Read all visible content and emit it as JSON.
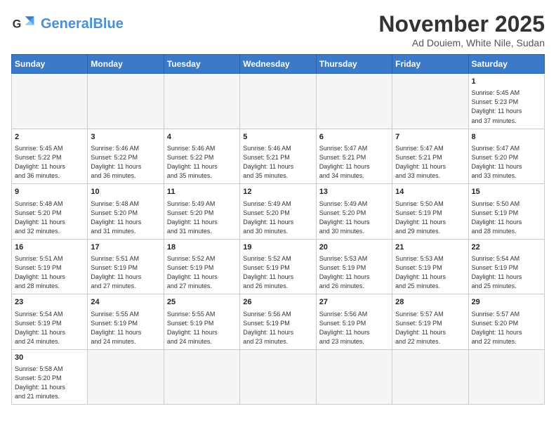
{
  "header": {
    "logo_general": "General",
    "logo_blue": "Blue",
    "month_title": "November 2025",
    "location": "Ad Douiem, White Nile, Sudan"
  },
  "days_of_week": [
    "Sunday",
    "Monday",
    "Tuesday",
    "Wednesday",
    "Thursday",
    "Friday",
    "Saturday"
  ],
  "weeks": [
    [
      {
        "day": null,
        "info": null
      },
      {
        "day": null,
        "info": null
      },
      {
        "day": null,
        "info": null
      },
      {
        "day": null,
        "info": null
      },
      {
        "day": null,
        "info": null
      },
      {
        "day": null,
        "info": null
      },
      {
        "day": "1",
        "info": "Sunrise: 5:45 AM\nSunset: 5:23 PM\nDaylight: 11 hours\nand 37 minutes."
      }
    ],
    [
      {
        "day": "2",
        "info": "Sunrise: 5:45 AM\nSunset: 5:22 PM\nDaylight: 11 hours\nand 36 minutes."
      },
      {
        "day": "3",
        "info": "Sunrise: 5:46 AM\nSunset: 5:22 PM\nDaylight: 11 hours\nand 36 minutes."
      },
      {
        "day": "4",
        "info": "Sunrise: 5:46 AM\nSunset: 5:22 PM\nDaylight: 11 hours\nand 35 minutes."
      },
      {
        "day": "5",
        "info": "Sunrise: 5:46 AM\nSunset: 5:21 PM\nDaylight: 11 hours\nand 35 minutes."
      },
      {
        "day": "6",
        "info": "Sunrise: 5:47 AM\nSunset: 5:21 PM\nDaylight: 11 hours\nand 34 minutes."
      },
      {
        "day": "7",
        "info": "Sunrise: 5:47 AM\nSunset: 5:21 PM\nDaylight: 11 hours\nand 33 minutes."
      },
      {
        "day": "8",
        "info": "Sunrise: 5:47 AM\nSunset: 5:20 PM\nDaylight: 11 hours\nand 33 minutes."
      }
    ],
    [
      {
        "day": "9",
        "info": "Sunrise: 5:48 AM\nSunset: 5:20 PM\nDaylight: 11 hours\nand 32 minutes."
      },
      {
        "day": "10",
        "info": "Sunrise: 5:48 AM\nSunset: 5:20 PM\nDaylight: 11 hours\nand 31 minutes."
      },
      {
        "day": "11",
        "info": "Sunrise: 5:49 AM\nSunset: 5:20 PM\nDaylight: 11 hours\nand 31 minutes."
      },
      {
        "day": "12",
        "info": "Sunrise: 5:49 AM\nSunset: 5:20 PM\nDaylight: 11 hours\nand 30 minutes."
      },
      {
        "day": "13",
        "info": "Sunrise: 5:49 AM\nSunset: 5:20 PM\nDaylight: 11 hours\nand 30 minutes."
      },
      {
        "day": "14",
        "info": "Sunrise: 5:50 AM\nSunset: 5:19 PM\nDaylight: 11 hours\nand 29 minutes."
      },
      {
        "day": "15",
        "info": "Sunrise: 5:50 AM\nSunset: 5:19 PM\nDaylight: 11 hours\nand 28 minutes."
      }
    ],
    [
      {
        "day": "16",
        "info": "Sunrise: 5:51 AM\nSunset: 5:19 PM\nDaylight: 11 hours\nand 28 minutes."
      },
      {
        "day": "17",
        "info": "Sunrise: 5:51 AM\nSunset: 5:19 PM\nDaylight: 11 hours\nand 27 minutes."
      },
      {
        "day": "18",
        "info": "Sunrise: 5:52 AM\nSunset: 5:19 PM\nDaylight: 11 hours\nand 27 minutes."
      },
      {
        "day": "19",
        "info": "Sunrise: 5:52 AM\nSunset: 5:19 PM\nDaylight: 11 hours\nand 26 minutes."
      },
      {
        "day": "20",
        "info": "Sunrise: 5:53 AM\nSunset: 5:19 PM\nDaylight: 11 hours\nand 26 minutes."
      },
      {
        "day": "21",
        "info": "Sunrise: 5:53 AM\nSunset: 5:19 PM\nDaylight: 11 hours\nand 25 minutes."
      },
      {
        "day": "22",
        "info": "Sunrise: 5:54 AM\nSunset: 5:19 PM\nDaylight: 11 hours\nand 25 minutes."
      }
    ],
    [
      {
        "day": "23",
        "info": "Sunrise: 5:54 AM\nSunset: 5:19 PM\nDaylight: 11 hours\nand 24 minutes."
      },
      {
        "day": "24",
        "info": "Sunrise: 5:55 AM\nSunset: 5:19 PM\nDaylight: 11 hours\nand 24 minutes."
      },
      {
        "day": "25",
        "info": "Sunrise: 5:55 AM\nSunset: 5:19 PM\nDaylight: 11 hours\nand 24 minutes."
      },
      {
        "day": "26",
        "info": "Sunrise: 5:56 AM\nSunset: 5:19 PM\nDaylight: 11 hours\nand 23 minutes."
      },
      {
        "day": "27",
        "info": "Sunrise: 5:56 AM\nSunset: 5:19 PM\nDaylight: 11 hours\nand 23 minutes."
      },
      {
        "day": "28",
        "info": "Sunrise: 5:57 AM\nSunset: 5:19 PM\nDaylight: 11 hours\nand 22 minutes."
      },
      {
        "day": "29",
        "info": "Sunrise: 5:57 AM\nSunset: 5:20 PM\nDaylight: 11 hours\nand 22 minutes."
      }
    ],
    [
      {
        "day": "30",
        "info": "Sunrise: 5:58 AM\nSunset: 5:20 PM\nDaylight: 11 hours\nand 21 minutes."
      },
      {
        "day": null,
        "info": null
      },
      {
        "day": null,
        "info": null
      },
      {
        "day": null,
        "info": null
      },
      {
        "day": null,
        "info": null
      },
      {
        "day": null,
        "info": null
      },
      {
        "day": null,
        "info": null
      }
    ]
  ]
}
